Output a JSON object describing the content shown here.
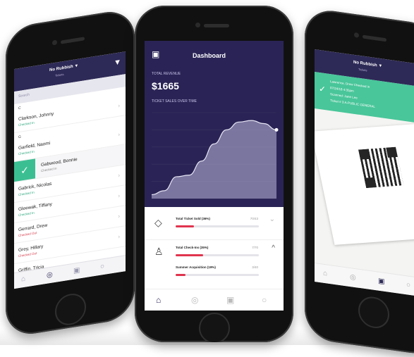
{
  "left_phone": {
    "header_title": "No Rubbish ▼",
    "header_sub": "Tickets",
    "search_placeholder": "Search",
    "groups": [
      "C",
      "G"
    ],
    "attendees": [
      {
        "name": "Clarkson, Johnny",
        "status": "Checked In",
        "status_type": "ok"
      },
      {
        "name": "Garfield, Naomi",
        "status": "Checked In",
        "status_type": "ok"
      },
      {
        "name": "Gabwood, Bonnie",
        "status": "Checked in",
        "status_type": "checked"
      },
      {
        "name": "Gabrick, Nicolas",
        "status": "Checked In",
        "status_type": "ok"
      },
      {
        "name": "Gleewak, Tiffany",
        "status": "Checked In",
        "status_type": "ok"
      },
      {
        "name": "Gerrard, Drew",
        "status": "Checked Out",
        "status_type": "out"
      },
      {
        "name": "Grey, Hillary",
        "status": "Checked Out",
        "status_type": "out"
      },
      {
        "name": "Griffin, Tricia",
        "status": "",
        "status_type": "ok"
      }
    ]
  },
  "center_phone": {
    "title": "Dashboard",
    "total_revenue_label": "TOTAL REVENUE",
    "total_revenue_value": "$1665",
    "chart_label": "TICKET SALES OVER TIME",
    "stats": [
      {
        "label": "Total Ticket Sold (36%)",
        "value": "70/43",
        "fill": 0.22
      },
      {
        "label": "Total Check-Ins (35%)",
        "value": "7/70",
        "fill": 0.33
      },
      {
        "label": "Summer Acquisition (19%)",
        "value": "3/40",
        "fill": 0.12
      }
    ]
  },
  "right_phone": {
    "header_title": "No Rubbish ▼",
    "header_sub": "Tickets",
    "banner_lines": [
      "Lawrence, Drew Checked in",
      "07/24/18 4:35pm",
      "Scanned: Jane Lee",
      "Ticket # 3 A-PUBLIC GENERAL"
    ]
  },
  "colors": {
    "header": "#2e2a57",
    "dashboard_bg": "#2a2456",
    "accent_green": "#3bbf92",
    "bar_red": "#e0344e"
  },
  "chart_data": {
    "type": "area",
    "title": "TICKET SALES OVER TIME",
    "x": [
      0,
      1,
      2,
      3,
      4,
      5,
      6,
      7,
      8,
      9,
      10
    ],
    "values": [
      5,
      10,
      28,
      30,
      48,
      70,
      88,
      98,
      100,
      96,
      88
    ],
    "ylim": [
      0,
      110
    ],
    "grid": true
  }
}
